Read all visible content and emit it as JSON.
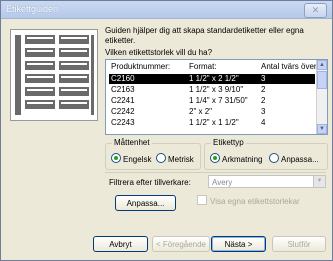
{
  "window": {
    "title": "Etikettguiden",
    "close_glyph": "✕"
  },
  "intro": "Guiden hjälper dig att skapa standardetiketter eller egna etiketter.",
  "question": "Vilken etikettstorlek vill du ha?",
  "list": {
    "columns": [
      "Produktnummer:",
      "Format:",
      "Antal tvärs över:"
    ],
    "rows": [
      {
        "product": "C2160",
        "format": "1 1/2\" x 2 1/2\"",
        "count": "3",
        "selected": true
      },
      {
        "product": "C2163",
        "format": "1 1/2\" x 3 9/10\"",
        "count": "2",
        "selected": false
      },
      {
        "product": "C2241",
        "format": "1 1/4\" x 7 31/50\"",
        "count": "2",
        "selected": false
      },
      {
        "product": "C2242",
        "format": "2\" x 2\"",
        "count": "3",
        "selected": false
      },
      {
        "product": "C2243",
        "format": "1 1/2\" x 1 1/2\"",
        "count": "4",
        "selected": false
      }
    ]
  },
  "units": {
    "legend": "Måttenhet",
    "options": [
      "Engelsk",
      "Metrisk"
    ],
    "selected": "Engelsk"
  },
  "label_type": {
    "legend": "Etikettyp",
    "options": [
      "Arkmatning",
      "Anpassa..."
    ],
    "selected": "Arkmatning"
  },
  "filter": {
    "label": "Filtrera efter tillverkare:",
    "value": "Avery"
  },
  "customize_button": "Anpassa...",
  "show_custom_checkbox": {
    "label": "Visa egna etikettstorlekar",
    "checked": false
  },
  "buttons": {
    "cancel": "Avbryt",
    "back": "< Föregående",
    "next": "Nästa >",
    "finish": "Slutför"
  }
}
